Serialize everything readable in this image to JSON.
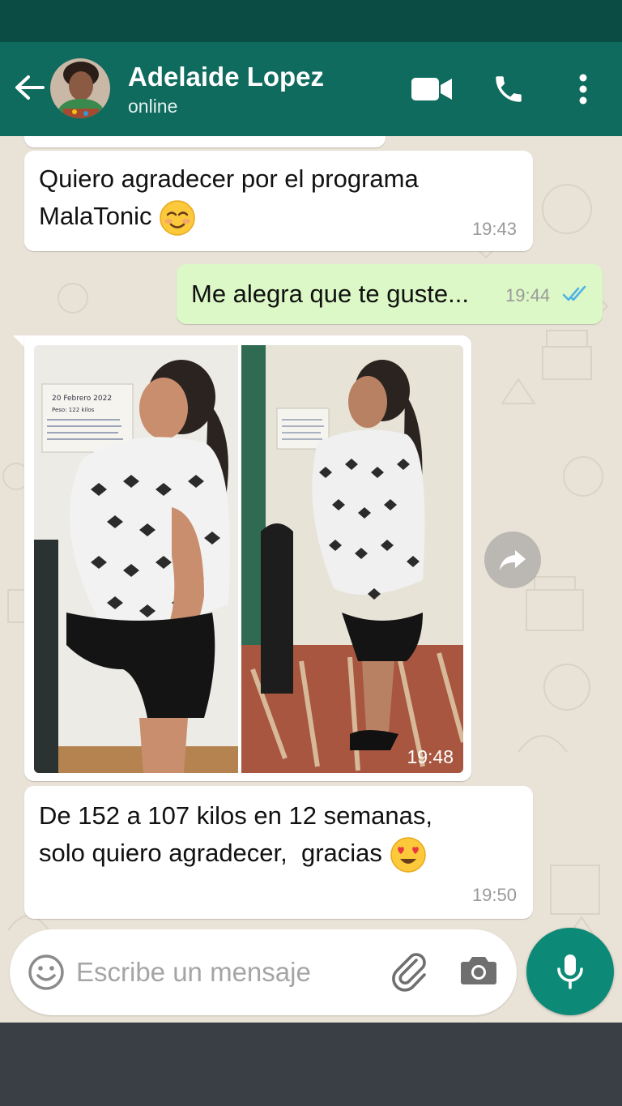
{
  "header": {
    "contact_name": "Adelaide Lopez",
    "status": "online"
  },
  "messages": [
    {
      "direction": "in",
      "text_lines": [
        "Quiero agradecer por el programa",
        "MalaTonic"
      ],
      "emoji": "relieved-smile",
      "time": "19:43"
    },
    {
      "direction": "out",
      "text": "Me alegra que te guste...",
      "time": "19:44",
      "read": true
    },
    {
      "direction": "in",
      "type": "image",
      "caption": "",
      "photo_labels": [
        "20 Febrero 2022",
        "Peso: 122 kilos"
      ],
      "time": "19:48"
    },
    {
      "direction": "in",
      "text_lines": [
        "De 152 a 107 kilos en 12 semanas,",
        "solo quiero agradecer,  gracias"
      ],
      "emoji": "heart-eyes",
      "time": "19:50"
    }
  ],
  "composer": {
    "placeholder": "Escribe un mensaje"
  },
  "colors": {
    "header": "#0e6b5e",
    "status_bar": "#0b4d44",
    "outgoing_bubble": "#dcf8c6",
    "incoming_bubble": "#ffffff",
    "mic_button": "#0c8a77",
    "read_ticks": "#4fb3e8"
  },
  "icons": [
    "back-arrow-icon",
    "video-call-icon",
    "phone-icon",
    "more-vert-icon",
    "forward-icon",
    "emoji-icon",
    "attach-icon",
    "camera-icon",
    "mic-icon",
    "double-check-icon"
  ]
}
